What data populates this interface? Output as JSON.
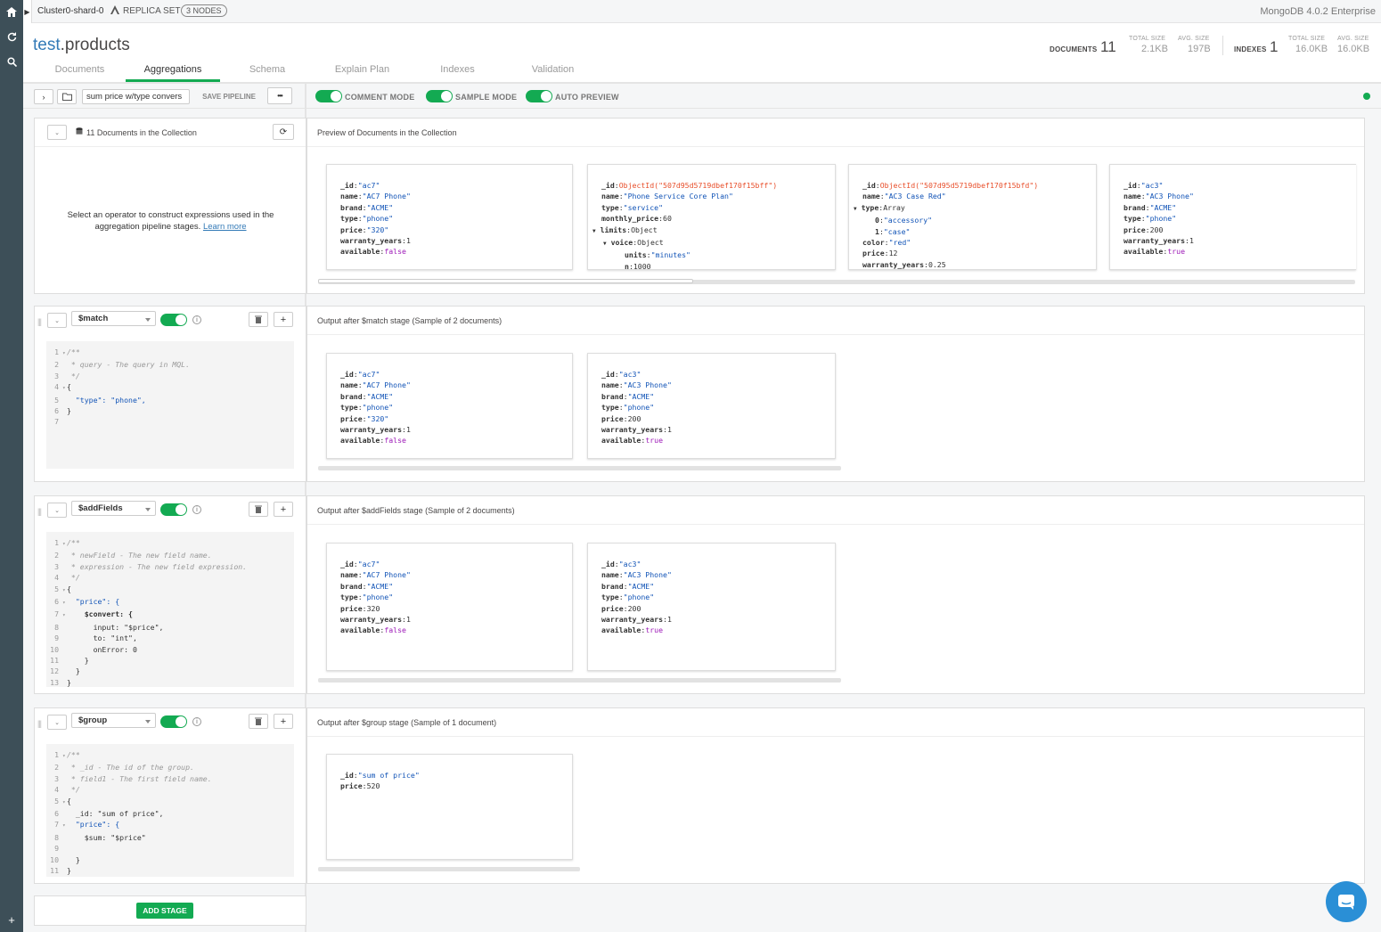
{
  "topbar": {
    "cluster": "Cluster0-shard-0",
    "replica_label": "REPLICA SET",
    "nodes_badge": "3 NODES",
    "version": "MongoDB 4.0.2 Enterprise"
  },
  "namespace": {
    "db": "test",
    "collection": ".products"
  },
  "tabs": [
    "Documents",
    "Aggregations",
    "Schema",
    "Explain Plan",
    "Indexes",
    "Validation"
  ],
  "active_tab": "Aggregations",
  "stats": {
    "documents_label": "DOCUMENTS",
    "documents_count": "11",
    "total_size_label": "TOTAL SIZE",
    "total_size": "2.1KB",
    "avg_size_label": "AVG. SIZE",
    "avg_size": "197B",
    "indexes_label": "INDEXES",
    "indexes_count": "1",
    "idx_total_size_label": "TOTAL SIZE",
    "idx_total_size": "16.0KB",
    "idx_avg_size_label": "AVG. SIZE",
    "idx_avg_size": "16.0KB"
  },
  "toolbar": {
    "pipeline_name": "sum price w/type convers",
    "save_pipeline": "SAVE PIPELINE",
    "more": "•••",
    "comment_mode": "COMMENT MODE",
    "sample_mode": "SAMPLE MODE",
    "auto_preview": "AUTO PREVIEW"
  },
  "source": {
    "count_label": "11 Documents in the Collection",
    "hint": "Select an operator to construct expressions used in the aggregation pipeline stages.",
    "learn_more": "Learn more",
    "preview_title": "Preview of Documents in the Collection"
  },
  "stages": [
    {
      "operator": "$match",
      "output_title": "Output after $match stage (Sample of 2 documents)"
    },
    {
      "operator": "$addFields",
      "output_title": "Output after $addFields stage (Sample of 2 documents)"
    },
    {
      "operator": "$group",
      "output_title": "Output after $group stage (Sample of 1 document)"
    }
  ],
  "add_stage": "ADD STAGE",
  "docs": {
    "preview": [
      [
        "_id",
        "\"ac7\"",
        "name",
        "\"AC7 Phone\"",
        "brand",
        "\"ACME\"",
        "type",
        "\"phone\"",
        "price",
        "\"320\"",
        "warranty_years",
        "1",
        "available",
        "false"
      ],
      [
        "_id",
        "ObjectId(\"507d95d5719dbef170f15bff\")",
        "name",
        "\"Phone Service Core Plan\"",
        "type",
        "\"service\"",
        "monthly_price",
        "60",
        "limits",
        "Object",
        "voice",
        "Object",
        "units",
        "\"minutes\"",
        "n",
        "1000"
      ],
      [
        "_id",
        "ObjectId(\"507d95d5719dbef170f15bfd\")",
        "name",
        "\"AC3 Case Red\"",
        "type",
        "Array",
        "0",
        "\"accessory\"",
        "1",
        "\"case\"",
        "color",
        "\"red\"",
        "price",
        "12",
        "warranty_years",
        "0.25"
      ],
      [
        "_id",
        "\"ac3\"",
        "name",
        "\"AC3 Phone\"",
        "brand",
        "\"ACME\"",
        "type",
        "\"phone\"",
        "price",
        "200",
        "warranty_years",
        "1",
        "available",
        "true"
      ]
    ],
    "match": [
      [
        "_id",
        "\"ac7\"",
        "name",
        "\"AC7 Phone\"",
        "brand",
        "\"ACME\"",
        "type",
        "\"phone\"",
        "price",
        "\"320\"",
        "warranty_years",
        "1",
        "available",
        "false"
      ],
      [
        "_id",
        "\"ac3\"",
        "name",
        "\"AC3 Phone\"",
        "brand",
        "\"ACME\"",
        "type",
        "\"phone\"",
        "price",
        "200",
        "warranty_years",
        "1",
        "available",
        "true"
      ]
    ],
    "addfields": [
      [
        "_id",
        "\"ac7\"",
        "name",
        "\"AC7 Phone\"",
        "brand",
        "\"ACME\"",
        "type",
        "\"phone\"",
        "price",
        "320",
        "warranty_years",
        "1",
        "available",
        "false"
      ],
      [
        "_id",
        "\"ac3\"",
        "name",
        "\"AC3 Phone\"",
        "brand",
        "\"ACME\"",
        "type",
        "\"phone\"",
        "price",
        "200",
        "warranty_years",
        "1",
        "available",
        "true"
      ]
    ],
    "group": [
      [
        "_id",
        "\"sum of price\"",
        "price",
        "520"
      ]
    ]
  },
  "code": {
    "match": [
      "/**",
      " * query - The query in MQL.",
      " */",
      "{",
      "  \"type\": \"phone\",",
      "}",
      ""
    ],
    "addfields": [
      "/**",
      " * newField - The new field name.",
      " * expression - The new field expression.",
      " */",
      "{",
      "  \"price\": {",
      "    $convert: {",
      "      input: \"$price\",",
      "      to: \"int\",",
      "      onError: 0",
      "    }",
      "  }",
      "}"
    ],
    "group": [
      "/**",
      " * _id - The id of the group.",
      " * field1 - The first field name.",
      " */",
      "{",
      "  _id: \"sum of price\",",
      "  \"price\": {",
      "    $sum: \"$price\"",
      "",
      "  }",
      "}"
    ]
  },
  "colors": {
    "accent": "#13aa52",
    "link": "#337ab7",
    "rail": "#3d4f58",
    "string": "#1254b7",
    "boolean": "#9e1bb8",
    "objectid": "#e84e2a"
  },
  "icons": [
    "home-icon",
    "refresh-icon",
    "search-icon",
    "plus-icon",
    "replica-set-icon",
    "folder-icon",
    "database-icon",
    "reload-icon",
    "trash-icon",
    "info-icon",
    "chat-icon"
  ]
}
